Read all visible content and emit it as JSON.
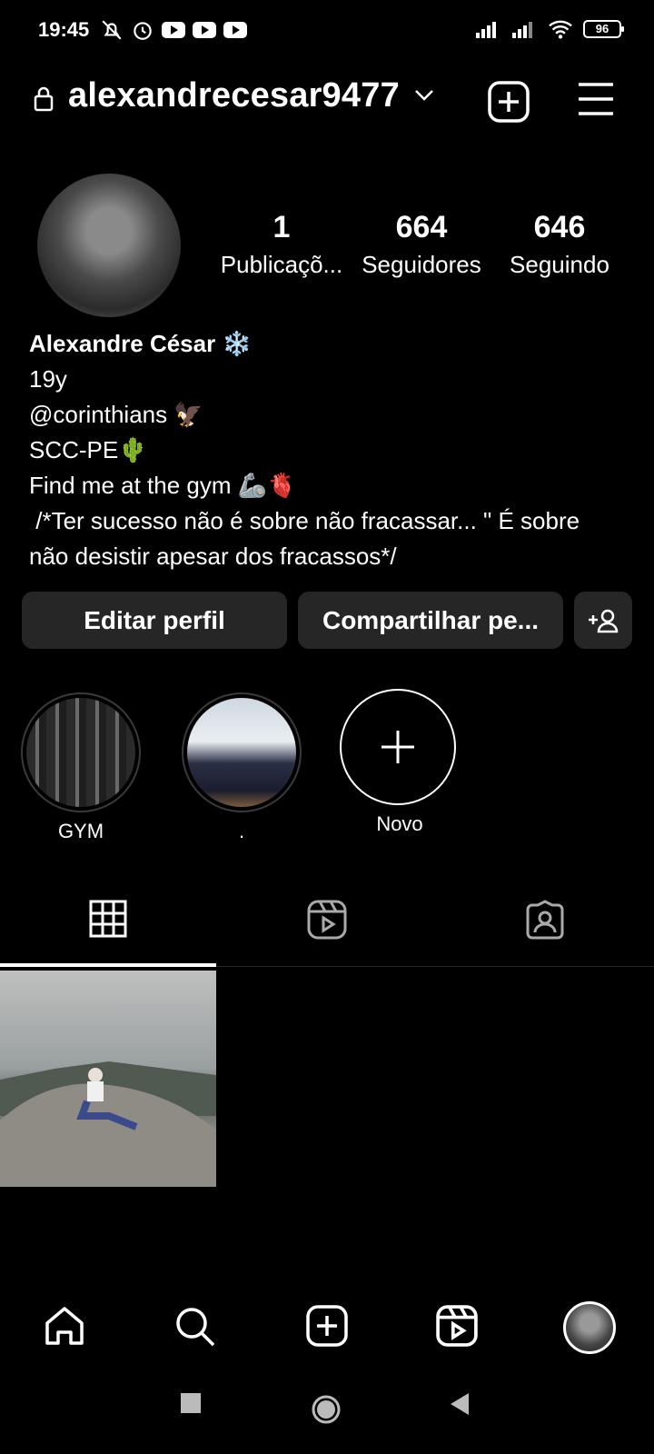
{
  "status_bar": {
    "time": "19:45",
    "battery": "96"
  },
  "header": {
    "username": "alexandrecesar9477"
  },
  "profile": {
    "stats": [
      {
        "value": "1",
        "label": "Publicaçõ..."
      },
      {
        "value": "664",
        "label": "Seguidores"
      },
      {
        "value": "646",
        "label": "Seguindo"
      }
    ],
    "bio": {
      "name": "Alexandre César ❄️",
      "lines": [
        "19y",
        "@corinthians 🦅",
        "SCC-PE🌵",
        "Find me at the gym 🦾🫀",
        " /*Ter sucesso não é sobre não fracassar... \" É sobre",
        "não desistir apesar dos fracassos*/"
      ]
    }
  },
  "buttons": {
    "edit": "Editar perfil",
    "share": "Compartilhar pe..."
  },
  "highlights": [
    {
      "label": "GYM"
    },
    {
      "label": "."
    },
    {
      "label": "Novo"
    }
  ],
  "icons": {
    "lock": "lock-icon",
    "chevron": "chevron-down-icon",
    "new_post": "plus-square-icon",
    "menu": "hamburger-menu-icon",
    "add_user": "add-person-icon",
    "grid": "grid-icon",
    "reels": "reels-icon",
    "tagged": "tagged-person-icon",
    "home": "home-icon",
    "search": "search-icon",
    "create": "create-icon",
    "reels_nav": "reels-nav-icon"
  }
}
